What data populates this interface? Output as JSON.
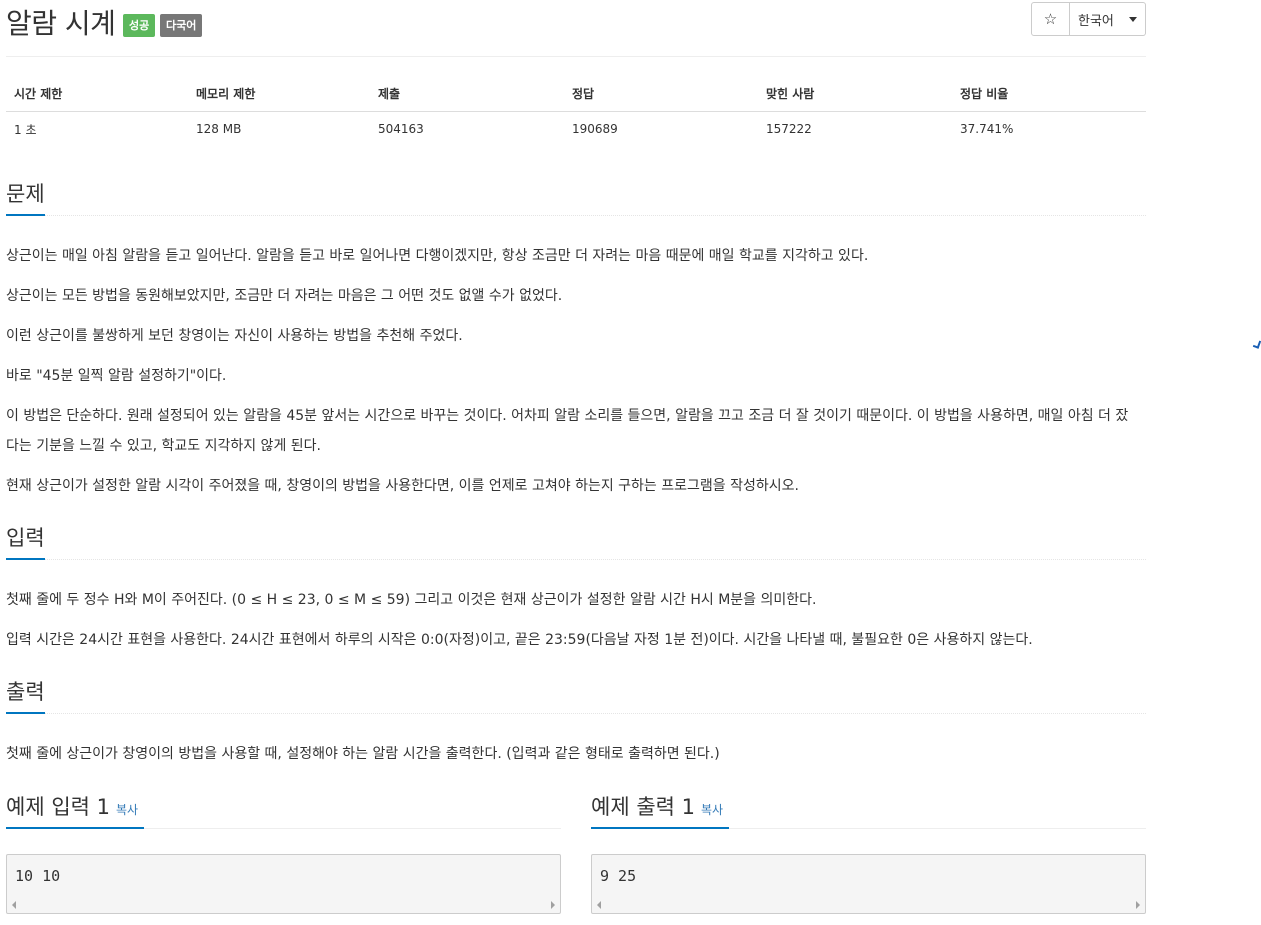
{
  "header": {
    "title": "알람 시계",
    "badge_status": "성공",
    "badge_lang": "다국어",
    "star_glyph": "☆",
    "language_select": "한국어"
  },
  "info": {
    "headers": [
      "시간 제한",
      "메모리 제한",
      "제출",
      "정답",
      "맞힌 사람",
      "정답 비율"
    ],
    "values": [
      "1 초",
      "128 MB",
      "504163",
      "190689",
      "157222",
      "37.741%"
    ]
  },
  "problem": {
    "heading": "문제",
    "paragraphs": [
      "상근이는 매일 아침 알람을 듣고 일어난다. 알람을 듣고 바로 일어나면 다행이겠지만, 항상 조금만 더 자려는 마음 때문에 매일 학교를 지각하고 있다.",
      "상근이는 모든 방법을 동원해보았지만, 조금만 더 자려는 마음은 그 어떤 것도 없앨 수가 없었다.",
      "이런 상근이를 불쌍하게 보던 창영이는 자신이 사용하는 방법을 추천해 주었다.",
      "바로 \"45분 일찍 알람 설정하기\"이다.",
      "이 방법은 단순하다. 원래 설정되어 있는 알람을 45분 앞서는 시간으로 바꾸는 것이다. 어차피 알람 소리를 들으면, 알람을 끄고 조금 더 잘 것이기 때문이다. 이 방법을 사용하면, 매일 아침 더 잤다는 기분을 느낄 수 있고, 학교도 지각하지 않게 된다.",
      "현재 상근이가 설정한 알람 시각이 주어졌을 때, 창영이의 방법을 사용한다면, 이를 언제로 고쳐야 하는지 구하는 프로그램을 작성하시오."
    ]
  },
  "input": {
    "heading": "입력",
    "paragraphs": [
      "첫째 줄에 두 정수 H와 M이 주어진다. (0 ≤ H ≤ 23, 0 ≤ M ≤ 59) 그리고 이것은 현재 상근이가 설정한 알람 시간 H시 M분을 의미한다.",
      "입력 시간은 24시간 표현을 사용한다. 24시간 표현에서 하루의 시작은 0:0(자정)이고, 끝은 23:59(다음날 자정 1분 전)이다. 시간을 나타낼 때, 불필요한 0은 사용하지 않는다."
    ]
  },
  "output": {
    "heading": "출력",
    "paragraphs": [
      "첫째 줄에 상근이가 창영이의 방법을 사용할 때, 설정해야 하는 알람 시간을 출력한다. (입력과 같은 형태로 출력하면 된다.)"
    ]
  },
  "samples": {
    "input_heading": "예제 입력 1",
    "output_heading": "예제 출력 1",
    "copy_label": "복사",
    "input_value": "10 10",
    "output_value": "9 25"
  },
  "colors": {
    "accent": "#0076c0",
    "success": "#5cb85c",
    "label_gray": "#777777",
    "link": "#337ab7"
  }
}
